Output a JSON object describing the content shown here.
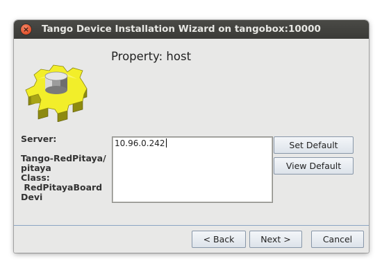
{
  "window": {
    "title": "Tango Device Installation Wizard on tangobox:10000",
    "close_glyph": "×"
  },
  "heading": "Property: host",
  "icon": "tango-gear-icon",
  "info_labels": [
    "Server:",
    "",
    "Tango-RedPitaya/",
    "pitaya",
    "Class:",
    " RedPitayaBoard",
    "Devi"
  ],
  "property_value": "10.96.0.242",
  "buttons": {
    "set_default": "Set Default",
    "view_default": "View Default",
    "back": "< Back",
    "next": "Next >",
    "cancel": "Cancel"
  },
  "colors": {
    "titlebar": "#3c3b37",
    "close": "#e2502a",
    "gear_yellow": "#f2ee2a",
    "button_border": "#8796a8",
    "divider": "#8aa4c3"
  }
}
